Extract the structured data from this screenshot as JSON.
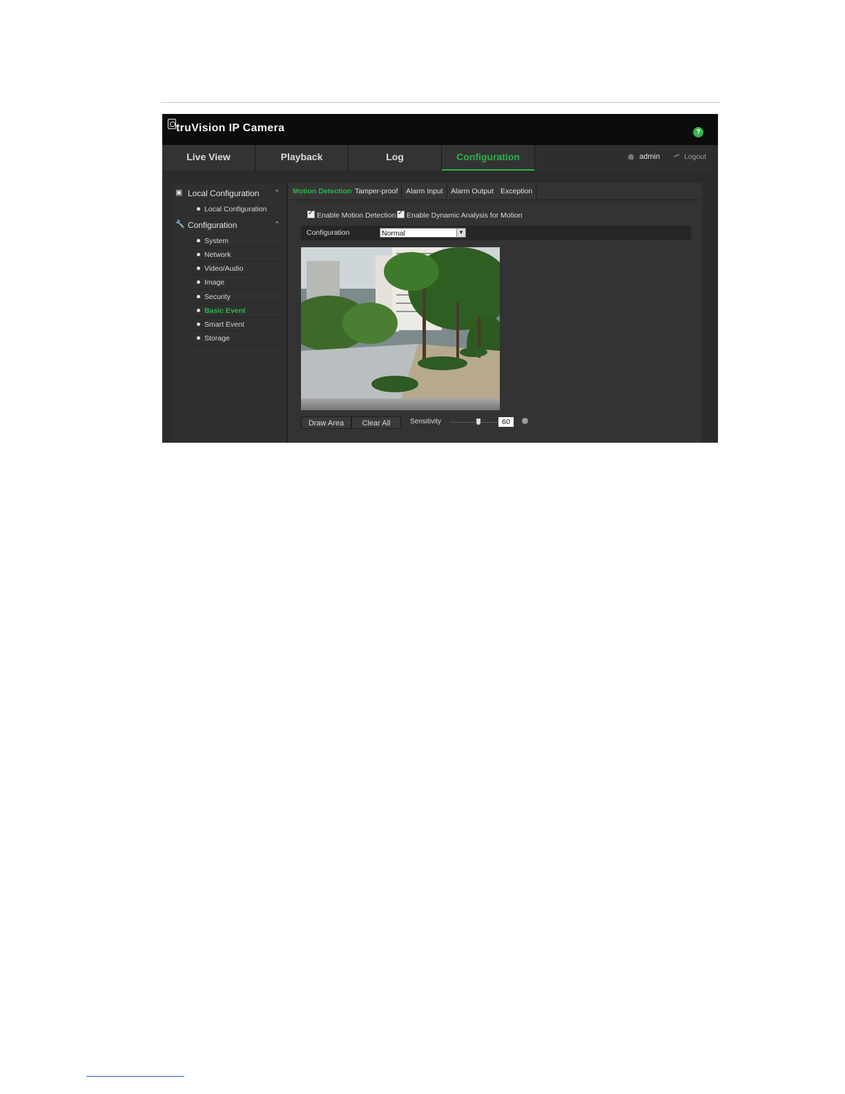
{
  "app": {
    "brand": "truVision  IP Camera"
  },
  "nav": {
    "tabs": [
      {
        "label": "Live View"
      },
      {
        "label": "Playback"
      },
      {
        "label": "Log"
      },
      {
        "label": "Configuration"
      }
    ],
    "active_tab": "Configuration",
    "user": "admin",
    "logout": "Logout"
  },
  "sidebar": {
    "sections": [
      {
        "label": "Local Configuration",
        "items": [
          "Local Configuration"
        ]
      },
      {
        "label": "Configuration",
        "items": [
          "System",
          "Network",
          "Video/Audio",
          "Image",
          "Security",
          "Basic Event",
          "Smart Event",
          "Storage"
        ]
      }
    ],
    "active_item": "Basic Event"
  },
  "subtabs": [
    "Motion Detection",
    "Tamper-proof",
    "Alarm Input",
    "Alarm Output",
    "Exception"
  ],
  "active_subtab": "Motion Detection",
  "form": {
    "enable_motion": "Enable Motion Detection",
    "enable_dynamic": "Enable Dynamic Analysis for Motion",
    "config_label": "Configuration",
    "config_value": "Normal"
  },
  "controls": {
    "draw_area": "Draw Area",
    "clear_all": "Clear All",
    "sensitivity_label": "Sensitivity",
    "sensitivity_value": "60"
  },
  "colors": {
    "accent": "#2bb34a",
    "titlebar": "#0c0c0c",
    "panel": "#2b2b2b"
  }
}
